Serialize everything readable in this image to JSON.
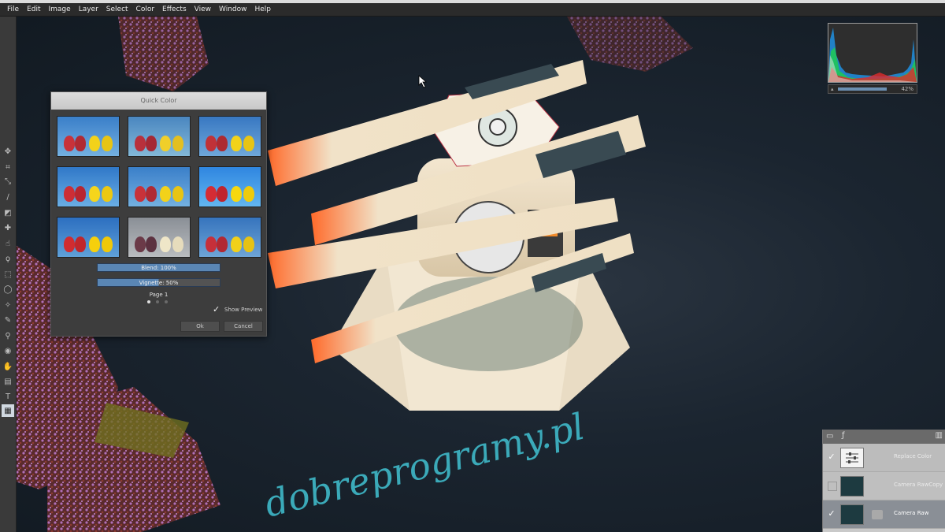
{
  "menu": [
    "File",
    "Edit",
    "Image",
    "Layer",
    "Select",
    "Color",
    "Effects",
    "View",
    "Window",
    "Help"
  ],
  "canvas": {
    "handwriting": "dobreprogramy.pl"
  },
  "toolbar": [
    "move-icon",
    "crop-icon",
    "transform-icon",
    "brush-icon",
    "eraser-icon",
    "clone-icon",
    "smudge-icon",
    "lasso-icon",
    "marquee-icon",
    "ellipse-select-icon",
    "magic-wand-icon",
    "pen-icon",
    "eyedropper-icon",
    "eye-icon",
    "hand-icon",
    "gradient-icon",
    "text-icon",
    "mesh-icon"
  ],
  "dialog": {
    "title": "Quick Color",
    "sliders": [
      {
        "label": "Blend: 100%",
        "value": 100
      },
      {
        "label": "Vignette: 50%",
        "value": 50
      }
    ],
    "page_label": "Page 1",
    "show_preview_label": "Show Preview",
    "ok_label": "Ok",
    "cancel_label": "Cancel"
  },
  "histogram": {
    "zoom": "42%"
  },
  "layers": [
    {
      "name": "Replace Color",
      "checked": true
    },
    {
      "name": "Camera RawCopy",
      "checked": false
    },
    {
      "name": "Camera Raw",
      "checked": true
    }
  ],
  "colors": {
    "menubar": "#2b2b2b",
    "accent": "#5a86b4",
    "canvas": "#16202a"
  }
}
